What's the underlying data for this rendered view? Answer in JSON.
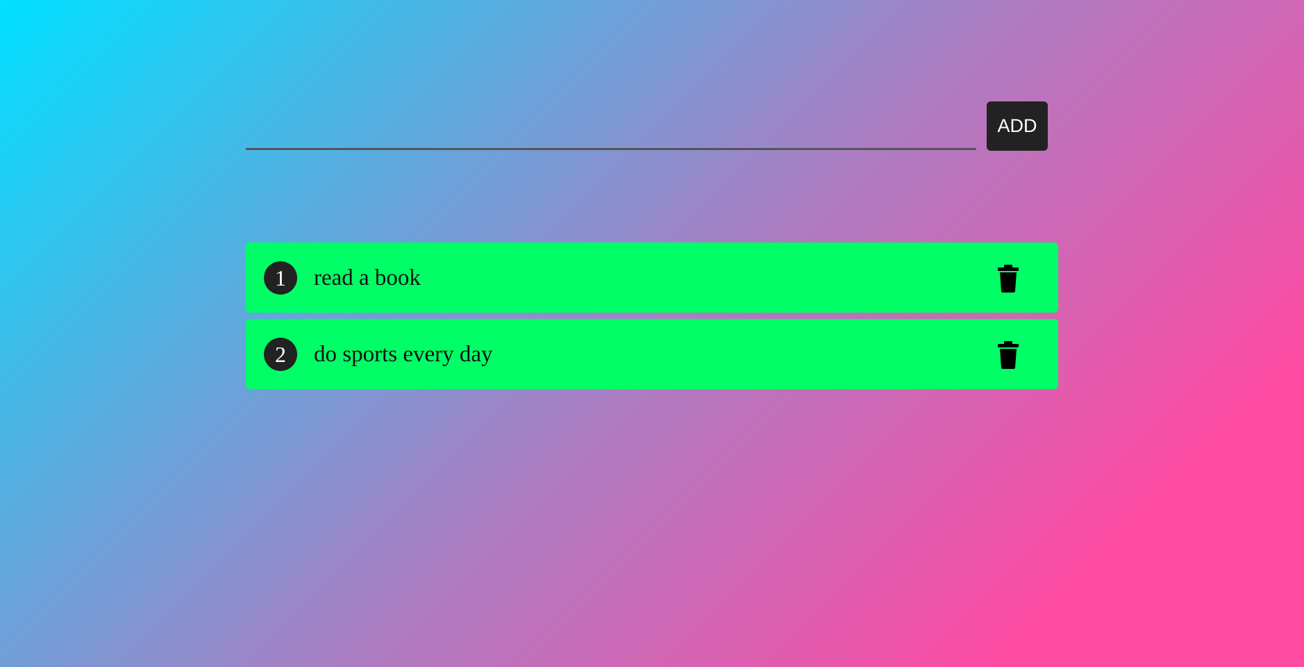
{
  "input": {
    "value": "",
    "placeholder": ""
  },
  "add_button": {
    "label": "ADD"
  },
  "todos": [
    {
      "number": "1",
      "text": "read a book",
      "delete_icon": "trash-icon"
    },
    {
      "number": "2",
      "text": "do sports every day",
      "delete_icon": "trash-icon"
    }
  ],
  "colors": {
    "item_background": "#00ff66",
    "button_background": "#222222",
    "gradient_start": "#00e0ff",
    "gradient_end": "#ff4aa2"
  }
}
